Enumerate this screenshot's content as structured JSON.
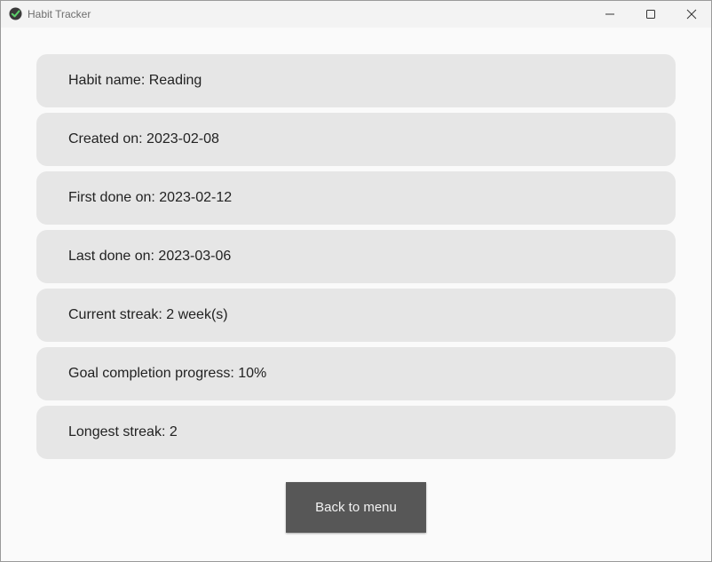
{
  "window": {
    "title": "Habit Tracker",
    "icon": "checkmark-badge-icon"
  },
  "titlebar_controls": {
    "minimize_icon": "minimize-icon",
    "maximize_icon": "maximize-icon",
    "close_icon": "close-icon"
  },
  "details": [
    {
      "label": "Habit name: Reading"
    },
    {
      "label": "Created on: 2023-02-08"
    },
    {
      "label": "First done on: 2023-02-12"
    },
    {
      "label": "Last done on: 2023-03-06"
    },
    {
      "label": "Current streak: 2 week(s)"
    },
    {
      "label": "Goal completion progress: 10%"
    },
    {
      "label": "Longest streak: 2"
    }
  ],
  "back_button": {
    "label": "Back to menu"
  },
  "colors": {
    "background": "#fafafa",
    "row_background": "#e6e6e6",
    "button_background": "#575757",
    "button_text": "#f2f2f2",
    "icon_accent": "#2f9e44"
  }
}
